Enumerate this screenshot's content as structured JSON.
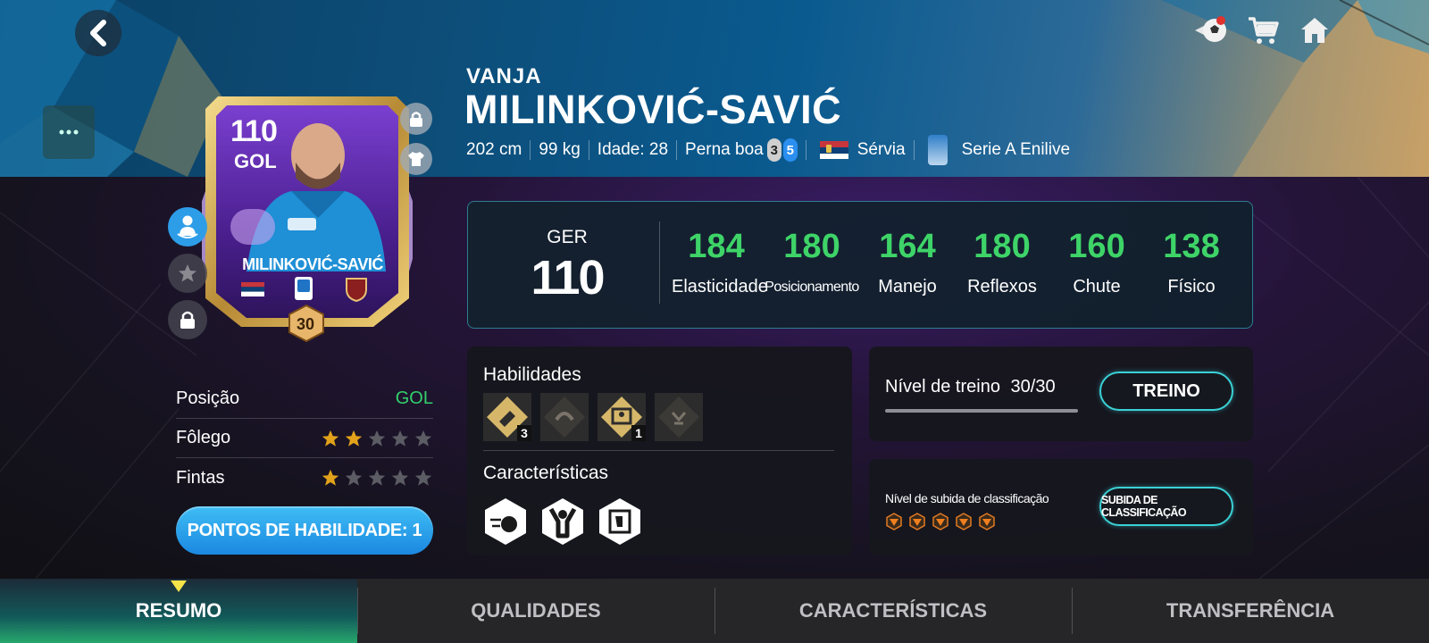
{
  "player": {
    "first_name": "VANJA",
    "last_name": "MILINKOVIĆ-SAVIĆ",
    "height": "202 cm",
    "weight": "99 kg",
    "age": "Idade: 28",
    "strong_foot_label": "Perna boa",
    "foot_left": "3",
    "foot_right": "5",
    "nation": "Sérvia",
    "league": "Serie A Enilive"
  },
  "card": {
    "rating": "110",
    "position": "GOL",
    "name": "MILINKOVIĆ-SAVIĆ",
    "training_level": "30",
    "program": "TOTS"
  },
  "left_stats": {
    "position_label": "Posição",
    "position_value": "GOL",
    "stamina_label": "Fôlego",
    "stamina_stars": 2,
    "skill_moves_label": "Fintas",
    "skill_moves_stars": 1,
    "max_stars": 5
  },
  "skill_points_button": "PONTOS DE HABILIDADE: 1",
  "overall": {
    "label": "GER",
    "value": "110",
    "stats": [
      {
        "value": "184",
        "label": "Elasticidade"
      },
      {
        "value": "180",
        "label": "Posicionamento"
      },
      {
        "value": "164",
        "label": "Manejo"
      },
      {
        "value": "180",
        "label": "Reflexos"
      },
      {
        "value": "160",
        "label": "Chute"
      },
      {
        "value": "138",
        "label": "Físico"
      }
    ]
  },
  "abilities": {
    "title": "Habilidades",
    "counts": [
      "3",
      "1"
    ],
    "traits_title": "Características"
  },
  "training": {
    "label": "Nível de treino",
    "progress": "30/30",
    "progress_fraction": 1.0,
    "button": "TREINO"
  },
  "rank_up": {
    "label": "Nível de subida de classificação",
    "pips": 5,
    "button": "SUBIDA DE CLASSIFICAÇÃO"
  },
  "tabs": [
    "RESUMO",
    "QUALIDADES",
    "CARACTERÍSTICAS",
    "TRANSFERÊNCIA"
  ],
  "active_tab": "RESUMO",
  "colors": {
    "stat_green": "#3ed468",
    "accent_cyan": "#3ad1d6",
    "skill_blue": "#1b88e0",
    "star_gold": "#e2a21a"
  }
}
